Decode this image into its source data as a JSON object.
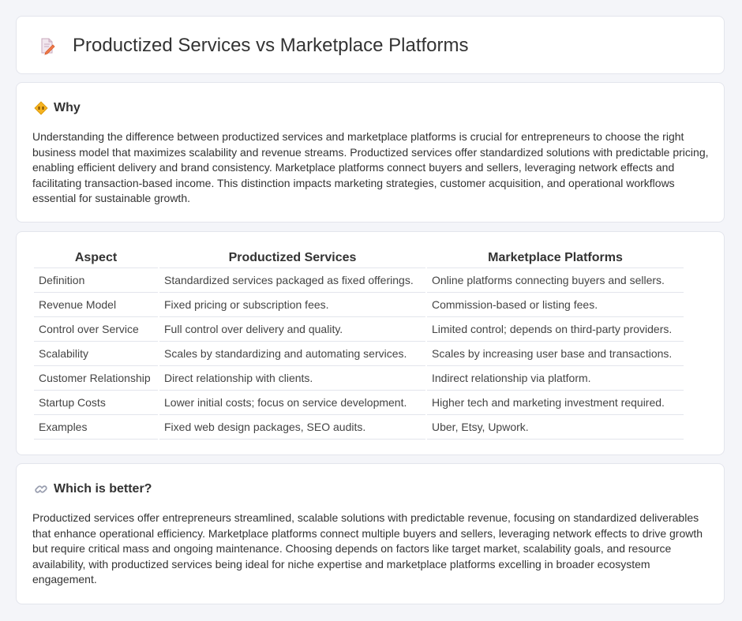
{
  "page": {
    "title": "Productized Services vs Marketplace Platforms",
    "title_icon": "document-pencil-icon"
  },
  "why": {
    "heading": "Why",
    "icon": "diamond-sign-icon",
    "text": "Understanding the difference between productized services and marketplace platforms is crucial for entrepreneurs to choose the right business model that maximizes scalability and revenue streams. Productized services offer standardized solutions with predictable pricing, enabling efficient delivery and brand consistency. Marketplace platforms connect buyers and sellers, leveraging network effects and facilitating transaction-based income. This distinction impacts marketing strategies, customer acquisition, and operational workflows essential for sustainable growth."
  },
  "table": {
    "headers": [
      "Aspect",
      "Productized Services",
      "Marketplace Platforms"
    ],
    "rows": [
      [
        "Definition",
        "Standardized services packaged as fixed offerings.",
        "Online platforms connecting buyers and sellers."
      ],
      [
        "Revenue Model",
        "Fixed pricing or subscription fees.",
        "Commission-based or listing fees."
      ],
      [
        "Control over Service",
        "Full control over delivery and quality.",
        "Limited control; depends on third-party providers."
      ],
      [
        "Scalability",
        "Scales by standardizing and automating services.",
        "Scales by increasing user base and transactions."
      ],
      [
        "Customer Relationship",
        "Direct relationship with clients.",
        "Indirect relationship via platform."
      ],
      [
        "Startup Costs",
        "Lower initial costs; focus on service development.",
        "Higher tech and marketing investment required."
      ],
      [
        "Examples",
        "Fixed web design packages, SEO audits.",
        "Uber, Etsy, Upwork."
      ]
    ]
  },
  "better": {
    "heading": "Which is better?",
    "icon": "link-icon",
    "text": "Productized services offer entrepreneurs streamlined, scalable solutions with predictable revenue, focusing on standardized deliverables that enhance operational efficiency. Marketplace platforms connect multiple buyers and sellers, leveraging network effects to drive growth but require critical mass and ongoing maintenance. Choosing depends on factors like target market, scalability goals, and resource availability, with productized services being ideal for niche expertise and marketplace platforms excelling in broader ecosystem engagement."
  }
}
